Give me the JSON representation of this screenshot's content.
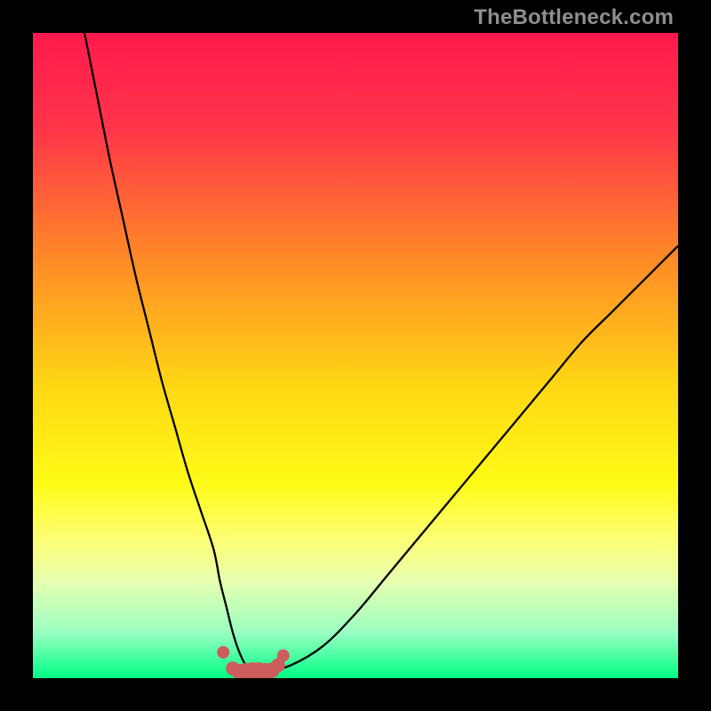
{
  "watermark": "TheBottleneck.com",
  "colors": {
    "frame": "#000000",
    "watermark": "#8e8e8e",
    "curve": "#000000",
    "dots": "#cd5c5c",
    "gradient_stops": [
      {
        "offset": 0.0,
        "color": "#ff1a4d"
      },
      {
        "offset": 0.15,
        "color": "#ff3549"
      },
      {
        "offset": 0.35,
        "color": "#ff8a27"
      },
      {
        "offset": 0.55,
        "color": "#ffd814"
      },
      {
        "offset": 0.7,
        "color": "#fffb17"
      },
      {
        "offset": 0.78,
        "color": "#fdff70"
      },
      {
        "offset": 0.85,
        "color": "#e7ffb0"
      },
      {
        "offset": 0.93,
        "color": "#99ffc2"
      },
      {
        "offset": 1.0,
        "color": "#00ff85"
      }
    ]
  },
  "chart_data": {
    "type": "line",
    "title": "",
    "xlabel": "",
    "ylabel": "",
    "xlim": [
      0,
      100
    ],
    "ylim": [
      0,
      100
    ],
    "series": [
      {
        "name": "bottleneck-curve",
        "x": [
          8,
          10,
          12,
          14,
          16,
          18,
          20,
          22,
          24,
          26,
          28,
          29,
          30,
          31,
          32,
          33,
          34,
          36,
          40,
          45,
          50,
          55,
          60,
          65,
          70,
          75,
          80,
          85,
          90,
          95,
          100
        ],
        "y": [
          100,
          90,
          80,
          71,
          62,
          54,
          46,
          39,
          32,
          26,
          20,
          15,
          11,
          7,
          4,
          2,
          1,
          1,
          2,
          5,
          10,
          16,
          22,
          28,
          34,
          40,
          46,
          52,
          57,
          62,
          67
        ]
      }
    ],
    "markers": {
      "name": "near-zero-dots",
      "x": [
        29.5,
        31,
        32,
        33,
        34,
        35,
        36,
        37,
        38,
        38.8
      ],
      "y": [
        4.0,
        1.5,
        1.0,
        1.0,
        1.0,
        1.0,
        1.0,
        1.2,
        2.0,
        3.5
      ]
    }
  }
}
